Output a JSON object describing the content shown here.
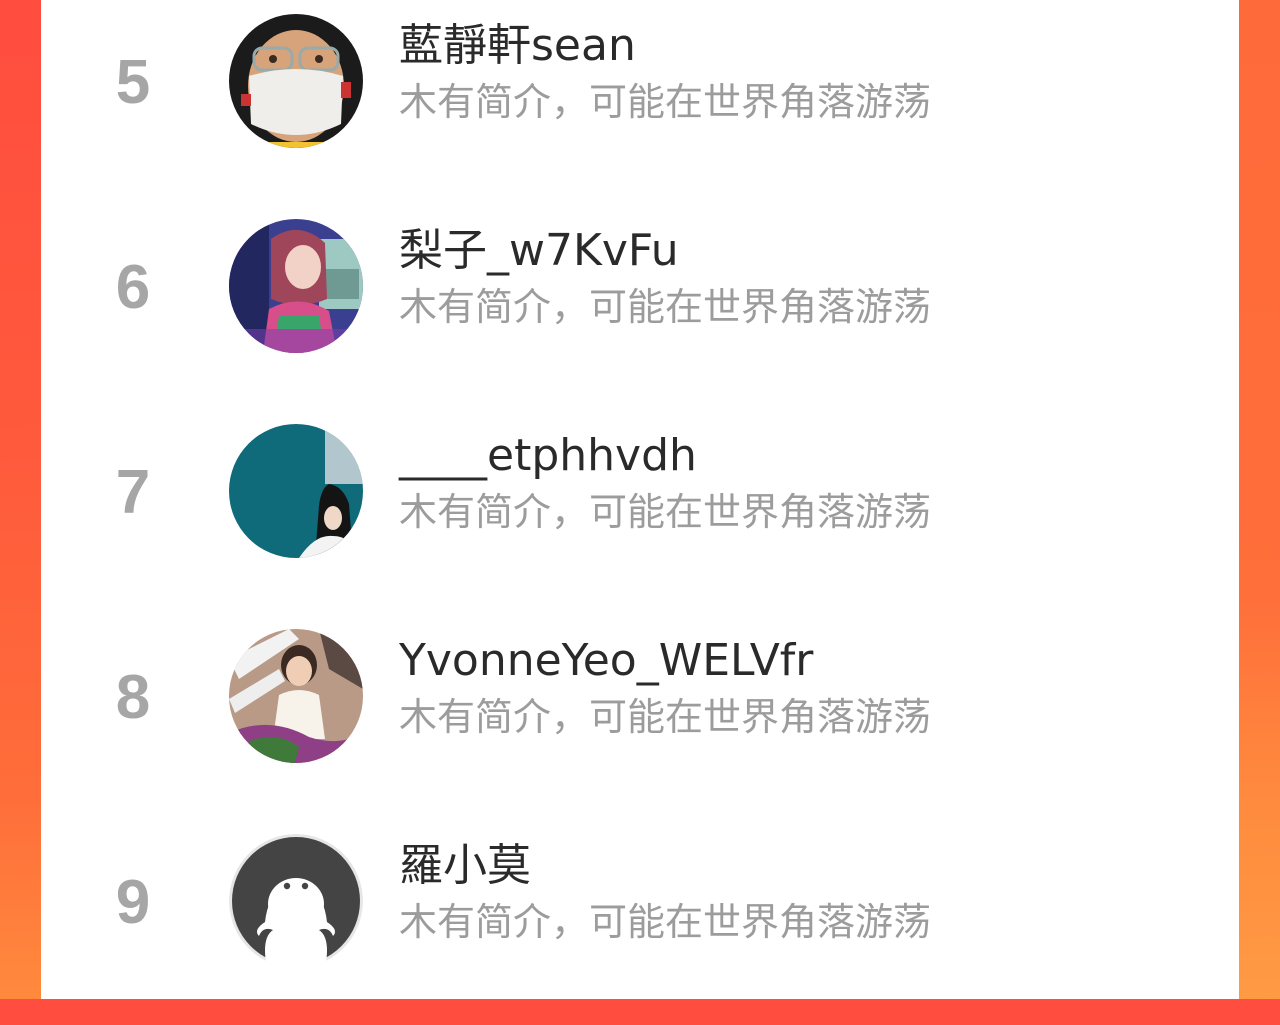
{
  "ranking": {
    "items": [
      {
        "rank": "5",
        "name": "藍靜軒sean",
        "bio": "木有简介，可能在世界角落游荡",
        "avatar_icon": "person-with-mask-avatar"
      },
      {
        "rank": "6",
        "name": "梨子_w7KvFu",
        "bio": "木有简介，可能在世界角落游荡",
        "avatar_icon": "anime-girl-avatar"
      },
      {
        "rank": "7",
        "name": "____etphhvdh",
        "bio": "木有简介，可能在世界角落游荡",
        "avatar_icon": "girl-teal-background-avatar"
      },
      {
        "rank": "8",
        "name": "YvonneYeo_WELVfr",
        "bio": "木有简介，可能在世界角落游荡",
        "avatar_icon": "child-photo-avatar"
      },
      {
        "rank": "9",
        "name": "羅小莫",
        "bio": "木有简介，可能在世界角落游荡",
        "avatar_icon": "default-ghost-avatar"
      }
    ]
  },
  "colors": {
    "background_gradient_start": "#ff4d3f",
    "background_gradient_end": "#ff8a3d",
    "rank_text": "#a6a6a6",
    "name_text": "#2a2a2a",
    "bio_text": "#9c9c9c"
  }
}
